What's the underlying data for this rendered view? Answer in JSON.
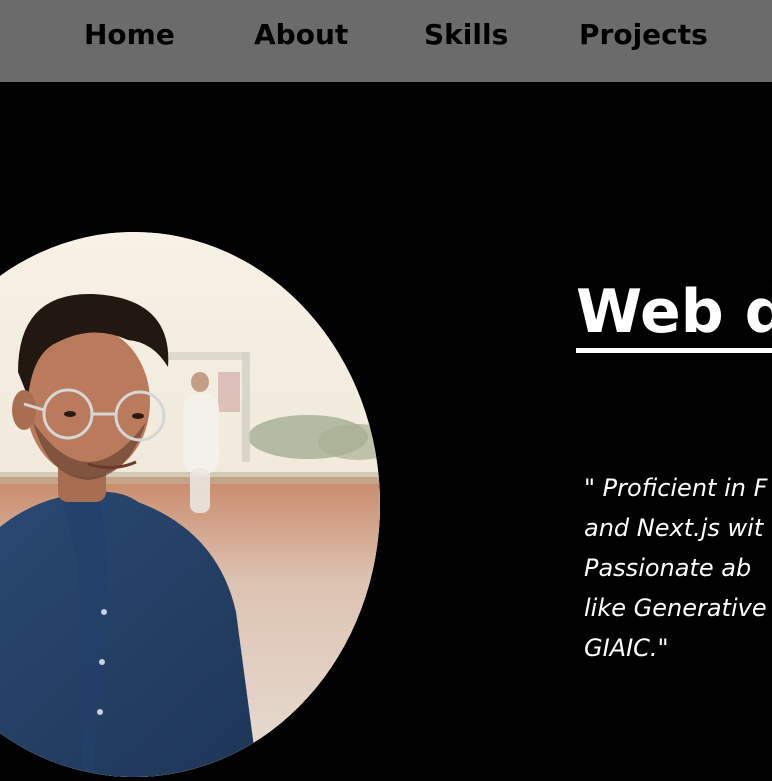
{
  "nav": {
    "items": [
      {
        "label": "Home"
      },
      {
        "label": "About"
      },
      {
        "label": "Skills"
      },
      {
        "label": "Projects"
      }
    ]
  },
  "hero": {
    "heading": "Web d",
    "quote_lines": [
      "\" Proficient in F",
      "and Next.js wit",
      "Passionate ab",
      "like Generative",
      "GIAIC.\""
    ]
  },
  "colors": {
    "nav_background": "#6b6b6b",
    "page_background": "#000000",
    "nav_text": "#000000",
    "hero_text": "#ffffff"
  },
  "icons": {
    "portrait": "profile-photo"
  }
}
